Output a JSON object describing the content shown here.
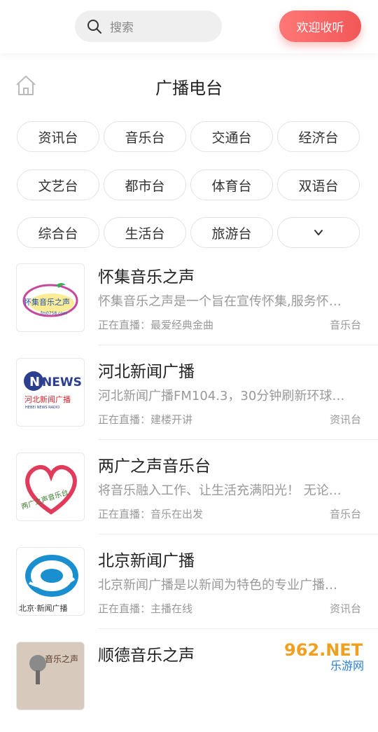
{
  "search": {
    "placeholder": "搜索"
  },
  "welcome_button": "欢迎收听",
  "page_title": "广播电台",
  "categories": [
    "资讯台",
    "音乐台",
    "交通台",
    "经济台",
    "文艺台",
    "都市台",
    "体育台",
    "双语台",
    "综合台",
    "生活台",
    "旅游台"
  ],
  "more_icon": "chevron-down-icon",
  "stations": [
    {
      "name": "怀集音乐之声",
      "desc": "怀集音乐之声是一个旨在宣传怀集,服务怀…",
      "live": "正在直播：最爱经典金曲",
      "category": "音乐台",
      "logo_text": "怀集音乐之声",
      "logo_subtext": "fm0758.com"
    },
    {
      "name": "河北新闻广播",
      "desc": "河北新闻广播FM104.3，30分钟刷新环球…",
      "live": "正在直播：建楼开讲",
      "category": "资讯台",
      "logo_text": "NEWS",
      "logo_subtext": "河北新闻广播",
      "logo_caption": "HEBEI NEWS RADIO"
    },
    {
      "name": "两广之声音乐台",
      "desc": "将音乐融入工作、让生活充满阳光！ 无论…",
      "live": "正在直播：音乐在出发",
      "category": "音乐台",
      "logo_text": "两广之声音乐台"
    },
    {
      "name": "北京新闻广播",
      "desc": "北京新闻广播是以新闻为特色的专业广播…",
      "live": "正在直播：主播在线",
      "category": "资讯台",
      "logo_text": "北京·新闻广播"
    },
    {
      "name": "顺德音乐之声",
      "desc": "",
      "live": "",
      "category": "",
      "logo_text": "音乐之声"
    }
  ],
  "watermark": {
    "brand": "962.NET",
    "sub": "乐游网"
  },
  "colors": {
    "accent": "#f25757",
    "chip_border": "#e3e3e3",
    "muted": "#999999"
  }
}
